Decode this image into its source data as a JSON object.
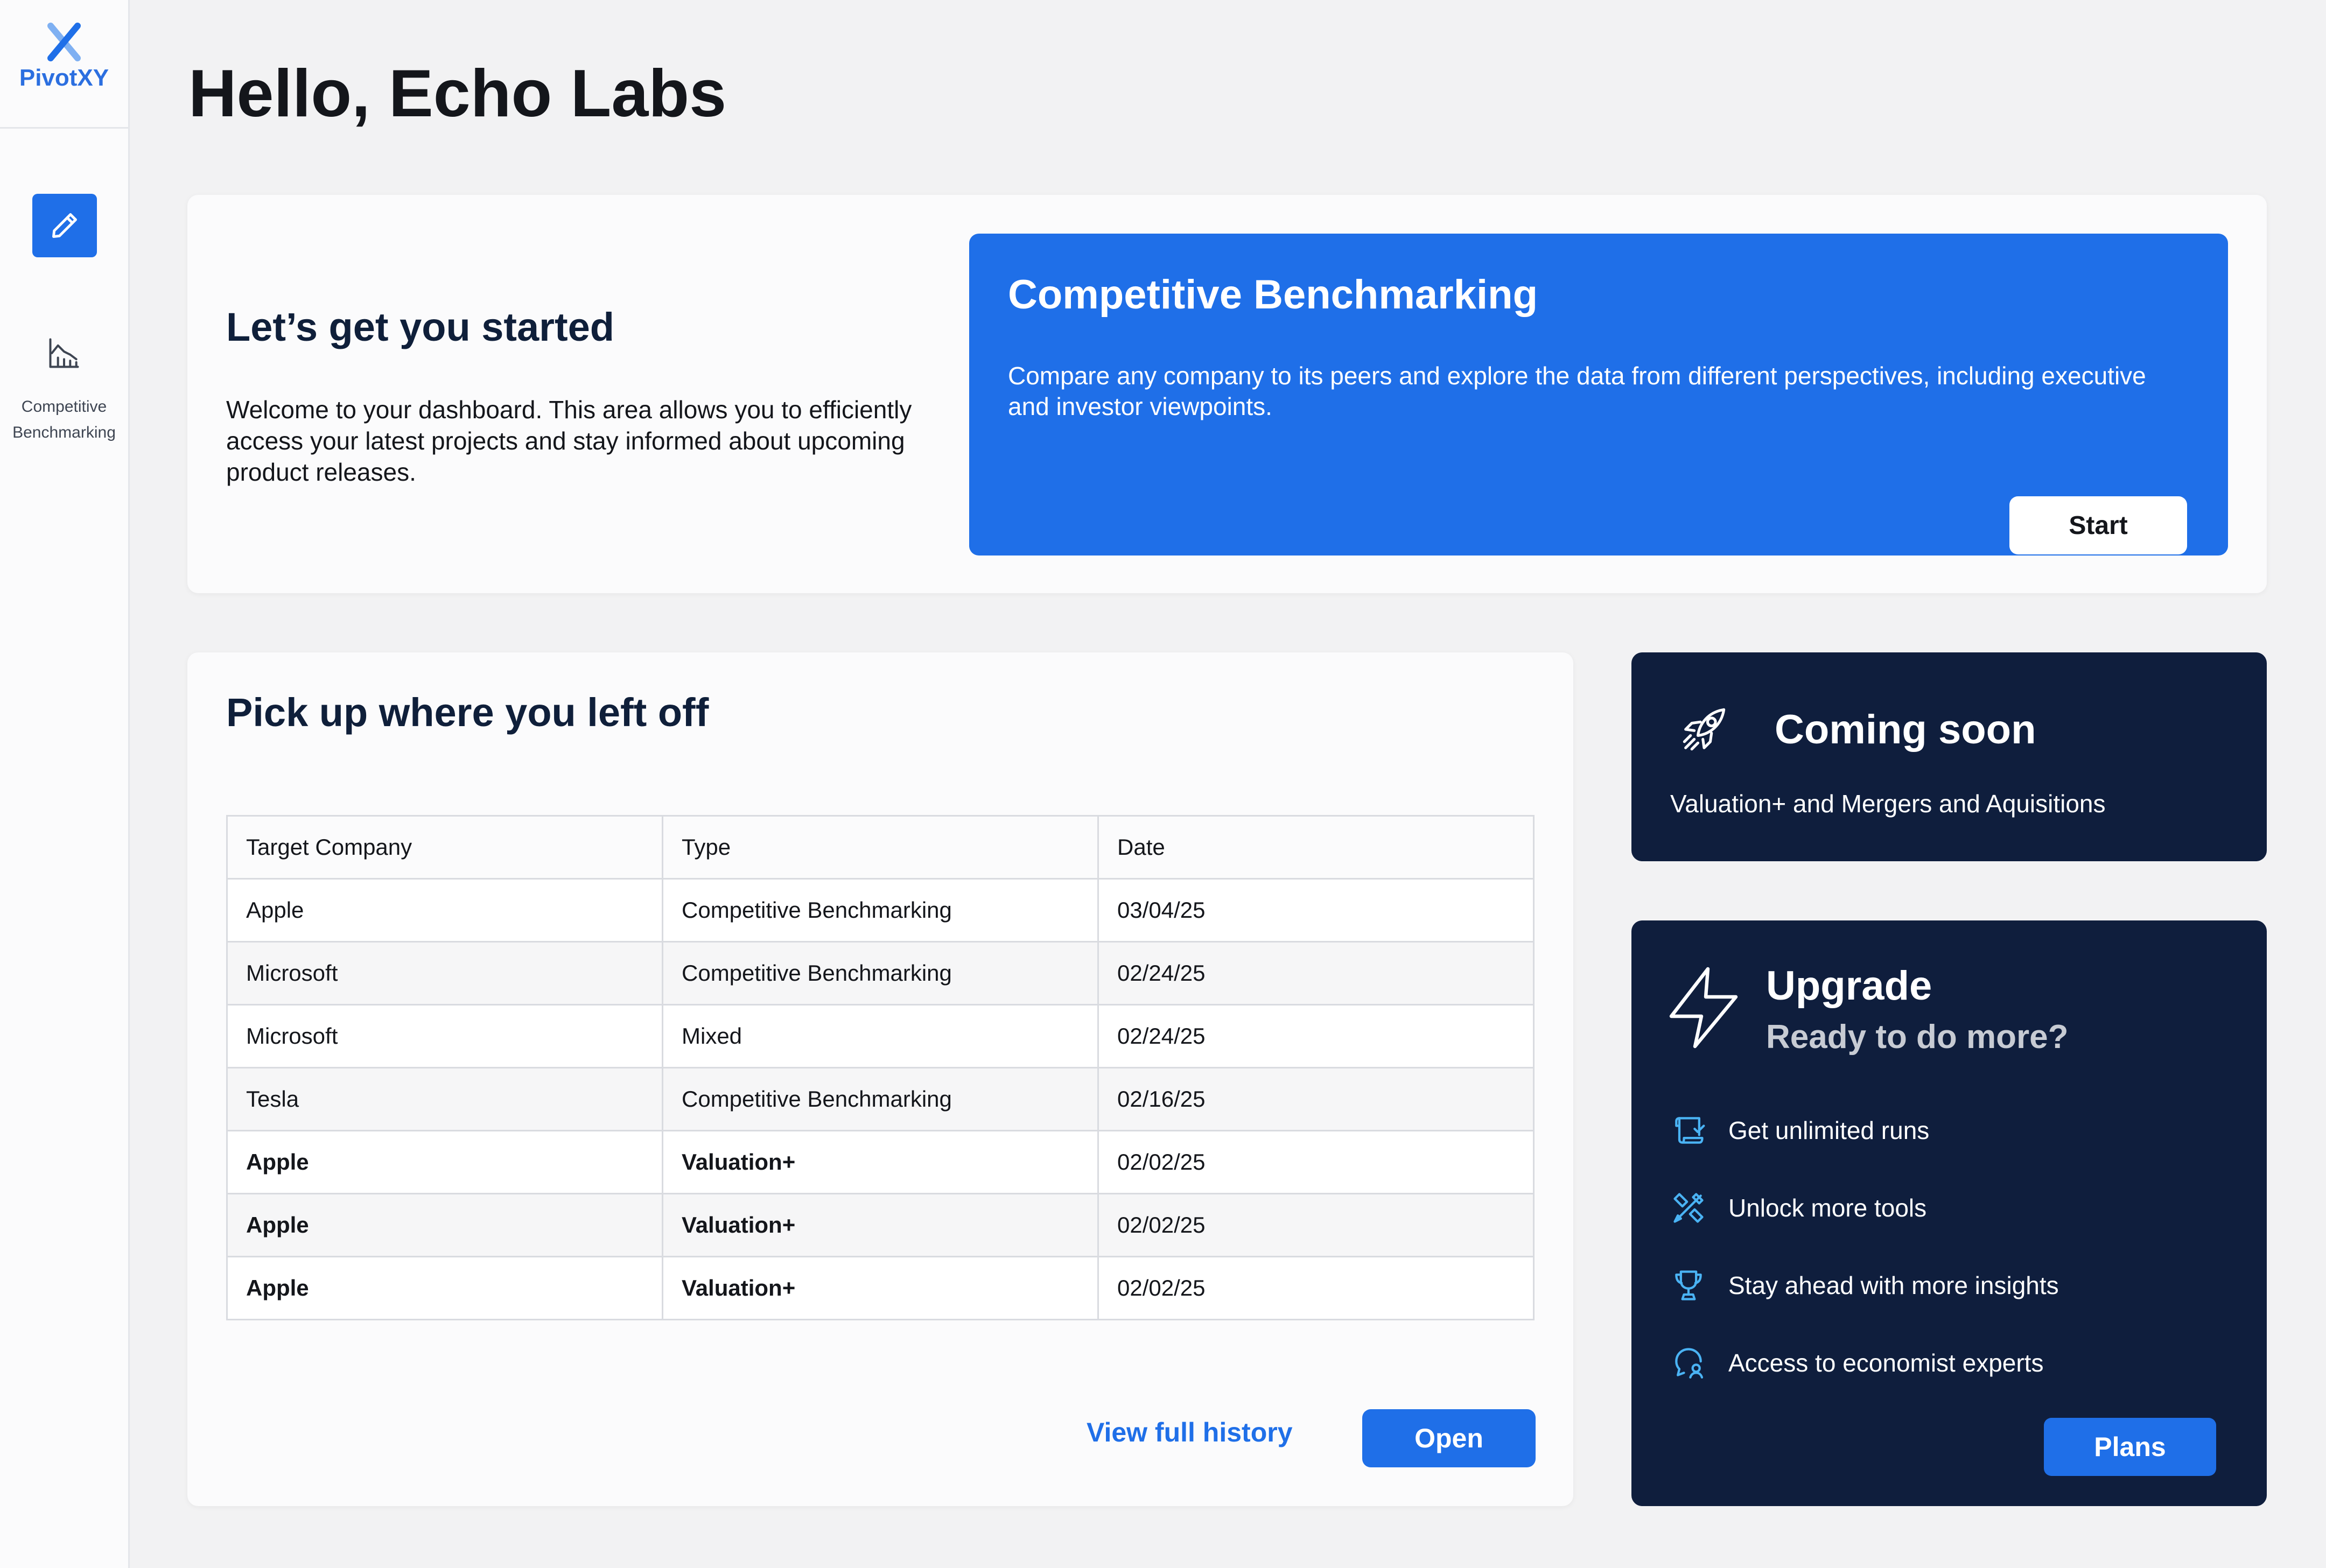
{
  "app": {
    "name": "PivotXY",
    "accent_color": "#1f6fe8",
    "navy_color": "#0f1e3d"
  },
  "sidebar": {
    "items": [
      {
        "label": "",
        "icon": "pencil-icon",
        "active": true
      },
      {
        "label": "Competitive Benchmarking",
        "icon": "chart-icon",
        "active": false
      }
    ]
  },
  "header": {
    "greeting": "Hello, Echo Labs"
  },
  "start_card": {
    "title": "Let’s get you started",
    "description": "Welcome to your dashboard. This area allows you to efficiently access your latest projects and stay informed about upcoming product releases.",
    "feature": {
      "title": "Competitive Benchmarking",
      "description": "Compare any company to its peers and explore the data from different perspectives, including executive and investor viewpoints.",
      "button": "Start"
    }
  },
  "history": {
    "title": "Pick up where you left off",
    "columns": [
      "Target Company",
      "Type",
      "Date"
    ],
    "rows": [
      [
        "Apple",
        "Competitive Benchmarking",
        "03/04/25"
      ],
      [
        "Microsoft",
        "Competitive Benchmarking",
        "02/24/25"
      ],
      [
        "Microsoft",
        "Mixed",
        "02/24/25"
      ],
      [
        "Tesla",
        "Competitive Benchmarking",
        "02/16/25"
      ],
      [
        "Apple",
        "Valuation+",
        "02/02/25"
      ],
      [
        "Apple",
        "Valuation+",
        "02/02/25"
      ],
      [
        "Apple",
        "Valuation+",
        "02/02/25"
      ]
    ],
    "link": "View full history",
    "button": "Open"
  },
  "coming_soon": {
    "icon": "rocket-icon",
    "title": "Coming soon",
    "description": "Valuation+ and Mergers and Aquisitions"
  },
  "upgrade": {
    "icon": "lightning-icon",
    "title": "Upgrade",
    "subtitle": "Ready to do more?",
    "benefits": [
      {
        "icon": "scroll-icon",
        "label": "Get unlimited runs"
      },
      {
        "icon": "tools-icon",
        "label": "Unlock more tools"
      },
      {
        "icon": "trophy-icon",
        "label": "Stay ahead with more insights"
      },
      {
        "icon": "expert-icon",
        "label": "Access to economist experts"
      }
    ],
    "button": "Plans"
  }
}
